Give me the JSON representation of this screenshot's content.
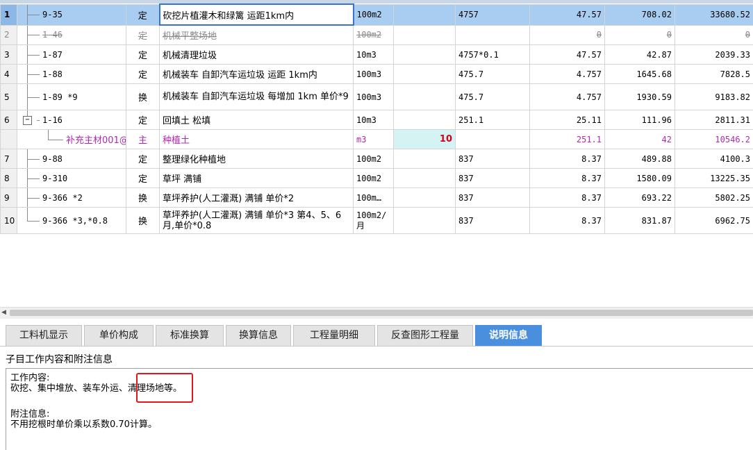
{
  "rows": [
    {
      "no": "1",
      "code": "9-35",
      "type": "定",
      "name": "砍挖片植灌木和绿篱 运距1km内",
      "unit": "100m2",
      "qty": "",
      "expr": "4757",
      "q2": "47.57",
      "price": "708.02",
      "total": "33680.52"
    },
    {
      "no": "2",
      "code": "1-46",
      "type": "定",
      "name": "机械平整场地",
      "unit": "100m2",
      "qty": "",
      "expr": "",
      "q2": "0",
      "price": "0",
      "total": "0"
    },
    {
      "no": "3",
      "code": "1-87",
      "type": "定",
      "name": "机械清理垃圾",
      "unit": "10m3",
      "qty": "",
      "expr": "4757*0.1",
      "q2": "47.57",
      "price": "42.87",
      "total": "2039.33"
    },
    {
      "no": "4",
      "code": "1-88",
      "type": "定",
      "name": "机械装车 自卸汽车运垃圾 运距 1km内",
      "unit": "100m3",
      "qty": "",
      "expr": "475.7",
      "q2": "4.757",
      "price": "1645.68",
      "total": "7828.5"
    },
    {
      "no": "5",
      "code": "1-89 *9",
      "type": "换",
      "name": "机械装车 自卸汽车运垃圾 每增加 1km 单价*9",
      "unit": "100m3",
      "qty": "",
      "expr": "475.7",
      "q2": "4.757",
      "price": "1930.59",
      "total": "9183.82"
    },
    {
      "no": "6",
      "code": "1-16",
      "type": "定",
      "name": "回填土 松填",
      "unit": "10m3",
      "qty": "",
      "expr": "251.1",
      "q2": "25.11",
      "price": "111.96",
      "total": "2811.31"
    },
    {
      "no": "",
      "code": "补充主材001@1",
      "type": "主",
      "name": "种植土",
      "unit": "m3",
      "qty": "10",
      "expr": "",
      "q2": "251.1",
      "price": "42",
      "total": "10546.2"
    },
    {
      "no": "7",
      "code": "9-88",
      "type": "定",
      "name": "整理绿化种植地",
      "unit": "100m2",
      "qty": "",
      "expr": "837",
      "q2": "8.37",
      "price": "489.88",
      "total": "4100.3"
    },
    {
      "no": "8",
      "code": "9-310",
      "type": "定",
      "name": "草坪 满铺",
      "unit": "100m2",
      "qty": "",
      "expr": "837",
      "q2": "8.37",
      "price": "1580.09",
      "total": "13225.35"
    },
    {
      "no": "9",
      "code": "9-366 *2",
      "type": "换",
      "name": "草坪养护(人工灌溉) 满铺  单价*2",
      "unit": "100m…",
      "qty": "",
      "expr": "837",
      "q2": "8.37",
      "price": "693.22",
      "total": "5802.25"
    },
    {
      "no": "10",
      "code": "9-366 *3,*0.8",
      "type": "换",
      "name": "草坪养护(人工灌溉) 满铺  单价*3 第4、5、6月,单价*0.8",
      "unit": "100m2/月",
      "qty": "",
      "expr": "837",
      "q2": "8.37",
      "price": "831.87",
      "total": "6962.75"
    }
  ],
  "tree": {
    "expander": "−"
  },
  "tabs": [
    "工料机显示",
    "单价构成",
    "标准换算",
    "换算信息",
    "工程量明细",
    "反查图形工程量",
    "说明信息"
  ],
  "panel": {
    "title": "子目工作内容和附注信息",
    "work_label": "工作内容:",
    "work_text": "砍挖、集中堆放、装车外运、清理场地等。",
    "note_label": "附注信息:",
    "note_text": "不用挖根时单价乘以系数0.70计算。"
  },
  "colors": {
    "selected": "#a9cdf1",
    "active_tab": "#4a8fdd",
    "material": "#b02ab0",
    "highlight": "#e3141b"
  }
}
